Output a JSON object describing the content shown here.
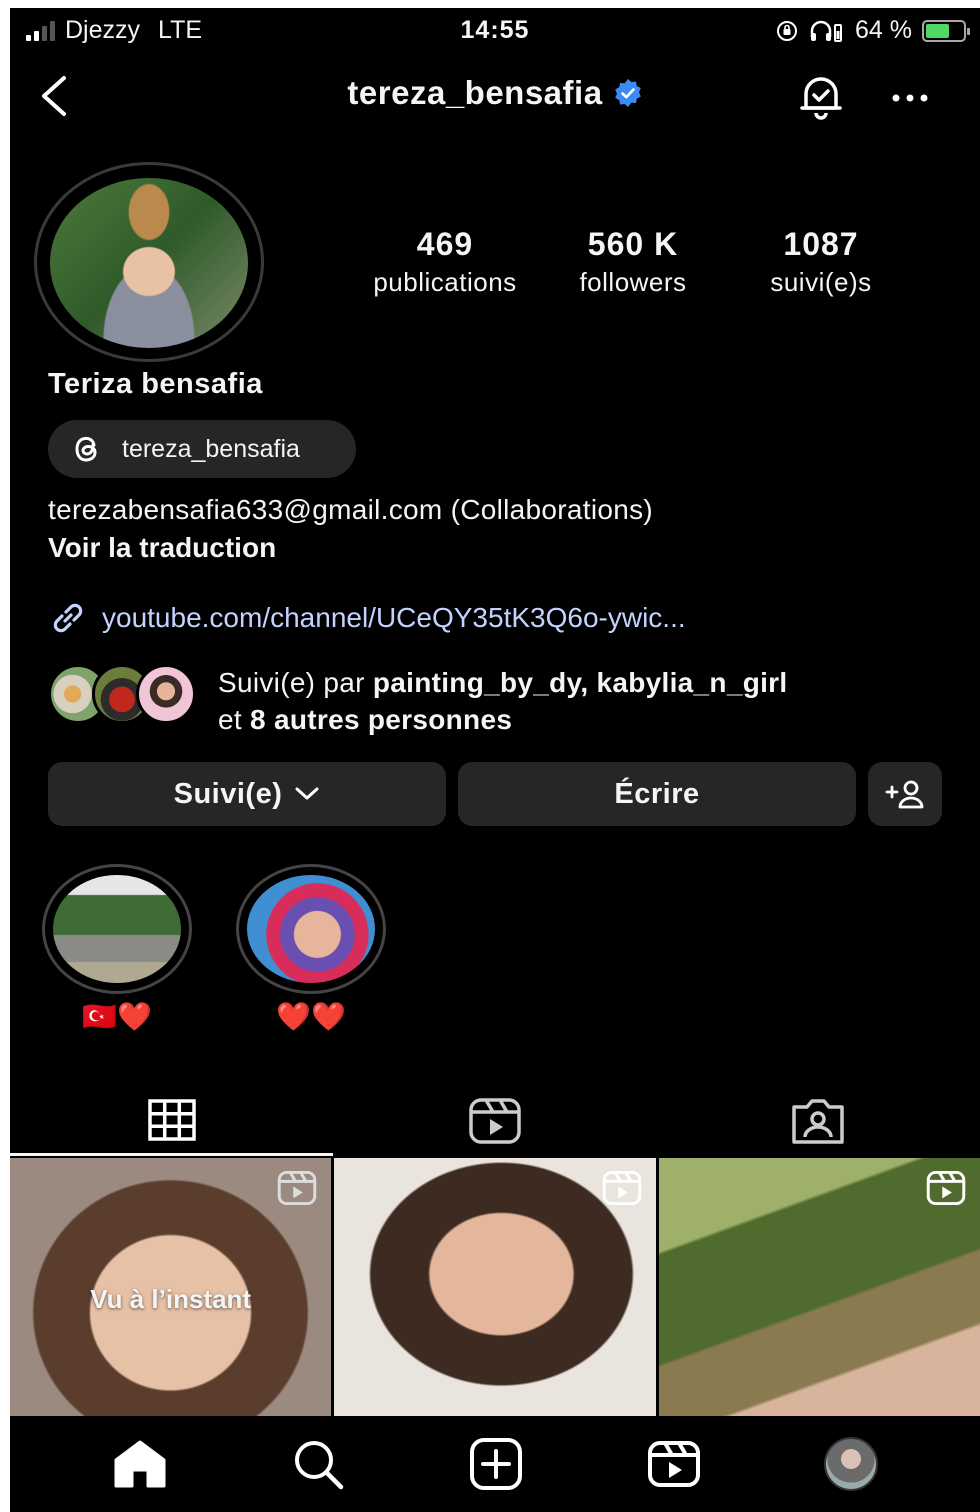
{
  "status": {
    "carrier": "Djezzy",
    "network": "LTE",
    "time": "14:55",
    "battery_pct": "64 %",
    "battery_level": 0.64
  },
  "header": {
    "username": "tereza_bensafia",
    "verified": true,
    "icons": [
      "back-chevron-icon",
      "bell-check-icon",
      "more-icon"
    ]
  },
  "profile": {
    "stats": [
      {
        "value": "469",
        "label": "publications"
      },
      {
        "value": "560 K",
        "label": "followers"
      },
      {
        "value": "1087",
        "label": "suivi(e)s"
      }
    ],
    "full_name": "Teriza bensafia",
    "threads_handle": "tereza_bensafia",
    "bio": "terezabensafia633@gmail.com (Collaborations)",
    "translate": "Voir la traduction",
    "link": "youtube.com/channel/UCeQY35tK3Q6o-ywic...",
    "followed_by": {
      "prefix": "Suivi(e) par ",
      "names": "painting_by_dy, kabylia_n_girl",
      "line2_prefix": "et ",
      "others": "8 autres personnes"
    }
  },
  "actions": {
    "following": "Suivi(e)",
    "message": "Écrire",
    "add_user": "+person-icon"
  },
  "highlights": [
    {
      "label": "🇹🇷❤️"
    },
    {
      "label": "❤️❤️"
    }
  ],
  "tabs": [
    "grid-icon",
    "reels-icon",
    "tagged-icon"
  ],
  "grid": [
    {
      "overlay": "Vu à l’instant",
      "is_reel": true
    },
    {
      "overlay": "",
      "is_reel": true
    },
    {
      "overlay": "",
      "is_reel": true
    }
  ],
  "colors": {
    "background": "#000000",
    "button": "#262626",
    "link": "#c3d2ff",
    "verified": "#3b8cf5"
  }
}
